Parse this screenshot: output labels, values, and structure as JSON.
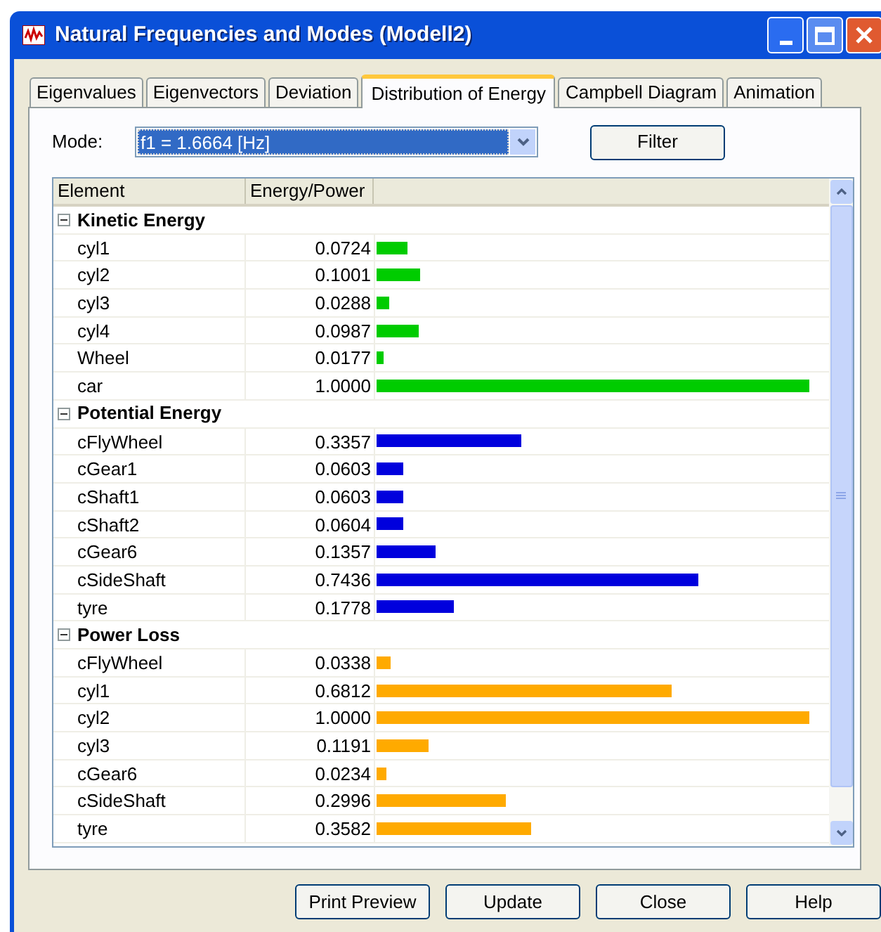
{
  "window": {
    "title": "Natural Frequencies and Modes (Modell2)"
  },
  "tabs": [
    {
      "label": "Eigenvalues",
      "selected": false
    },
    {
      "label": "Eigenvectors",
      "selected": false
    },
    {
      "label": "Deviation",
      "selected": false
    },
    {
      "label": "Distribution of Energy",
      "selected": true
    },
    {
      "label": "Campbell Diagram",
      "selected": false
    },
    {
      "label": "Animation",
      "selected": false
    }
  ],
  "mode": {
    "label": "Mode:",
    "value": "f1 = 1.6664 [Hz]"
  },
  "filter_button": {
    "label": "Filter"
  },
  "table": {
    "columns": [
      "Element",
      "Energy/Power"
    ],
    "groups": [
      {
        "title": "Kinetic Energy",
        "expanded": true,
        "color": "#00cc00",
        "rows": [
          {
            "name": "cyl1",
            "value": "0.0724",
            "level": 0.0724
          },
          {
            "name": "cyl2",
            "value": "0.1001",
            "level": 0.1001
          },
          {
            "name": "cyl3",
            "value": "0.0288",
            "level": 0.0288
          },
          {
            "name": "cyl4",
            "value": "0.0987",
            "level": 0.0987
          },
          {
            "name": "Wheel",
            "value": "0.0177",
            "level": 0.0177
          },
          {
            "name": "car",
            "value": "1.0000",
            "level": 1.0
          }
        ]
      },
      {
        "title": "Potential Energy",
        "expanded": true,
        "color": "#0000dd",
        "rows": [
          {
            "name": "cFlyWheel",
            "value": "0.3357",
            "level": 0.3357
          },
          {
            "name": "cGear1",
            "value": "0.0603",
            "level": 0.0603
          },
          {
            "name": "cShaft1",
            "value": "0.0603",
            "level": 0.0603
          },
          {
            "name": "cShaft2",
            "value": "0.0604",
            "level": 0.0604
          },
          {
            "name": "cGear6",
            "value": "0.1357",
            "level": 0.1357
          },
          {
            "name": "cSideShaft",
            "value": "0.7436",
            "level": 0.7436
          },
          {
            "name": "tyre",
            "value": "0.1778",
            "level": 0.1778
          }
        ]
      },
      {
        "title": "Power Loss",
        "expanded": true,
        "color": "#ffaa00",
        "rows": [
          {
            "name": "cFlyWheel",
            "value": "0.0338",
            "level": 0.0338
          },
          {
            "name": "cyl1",
            "value": "0.6812",
            "level": 0.6812
          },
          {
            "name": "cyl2",
            "value": "1.0000",
            "level": 1.0
          },
          {
            "name": "cyl3",
            "value": "0.1191",
            "level": 0.1191
          },
          {
            "name": "cGear6",
            "value": "0.0234",
            "level": 0.0234
          },
          {
            "name": "cSideShaft",
            "value": "0.2996",
            "level": 0.2996
          },
          {
            "name": "tyre",
            "value": "0.3582",
            "level": 0.3582
          }
        ]
      }
    ]
  },
  "buttons": [
    {
      "label": "Print Preview"
    },
    {
      "label": "Update"
    },
    {
      "label": "Close"
    },
    {
      "label": "Help"
    }
  ]
}
